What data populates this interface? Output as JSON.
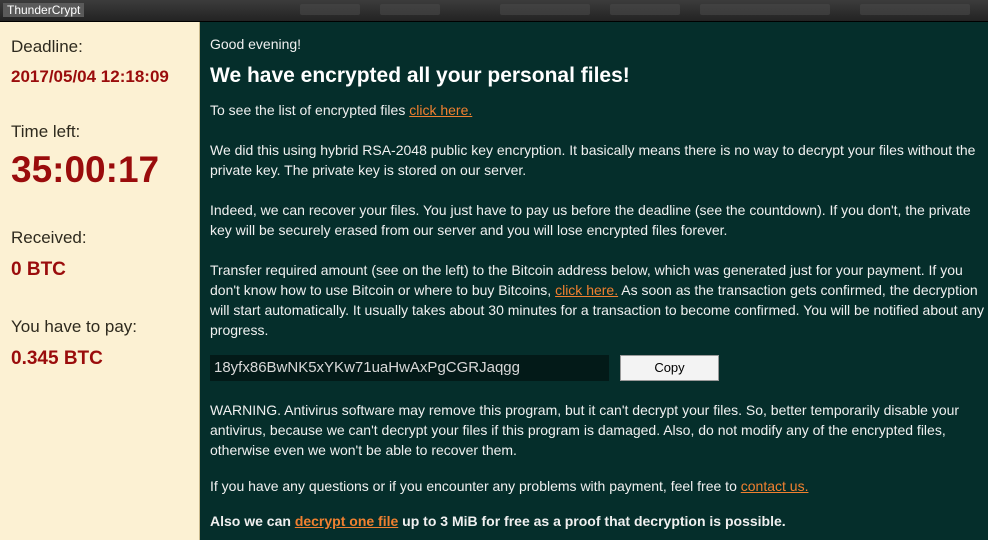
{
  "window": {
    "title": "ThunderCrypt"
  },
  "left_panel": {
    "deadline_label": "Deadline:",
    "deadline_value": "2017/05/04 12:18:09",
    "time_left_label": "Time left:",
    "time_left_value": "35:00:17",
    "received_label": "Received:",
    "received_value": "0 BTC",
    "to_pay_label": "You have to pay:",
    "to_pay_value": "0.345 BTC"
  },
  "main": {
    "greeting": "Good evening!",
    "headline": "We have encrypted all your personal files!",
    "list_text": "To see the list of encrypted files ",
    "list_link": "click here.",
    "para_encryption": "We did this using hybrid RSA-2048 public key encryption. It basically means there is no way to decrypt your files without the private key. The private key is stored on our server.",
    "para_deadline": "Indeed, we can recover your files. You just have to pay us before the deadline (see the countdown). If you don't, the private key will be securely erased from our server and you will lose encrypted files forever.",
    "para_transfer_1": "Transfer required amount (see on the left) to the Bitcoin address below, which was generated just for your payment. If you don't know how to use Bitcoin or where to buy Bitcoins, ",
    "para_transfer_link": "click here.",
    "para_transfer_2": " As soon as the transaction gets confirmed, the decryption will start automatically. It usually takes about 30 minutes for a transaction to become confirmed. You will be notified about any progress.",
    "bitcoin_address": "18yfx86BwNK5xYKw71uaHwAxPgCGRJaqgg",
    "copy_label": "Copy",
    "warning": "WARNING. Antivirus software may remove this program, but it can't decrypt your files. So, better temporarily disable your antivirus, because we can't decrypt your files if this program is damaged. Also, do not modify any of the encrypted files, otherwise even we won't be able to recover them.",
    "contact_text": "If you have any questions or if you encounter any problems with payment, feel free to ",
    "contact_link": "contact us.",
    "free_text_1": "Also we can ",
    "free_link": "decrypt one file",
    "free_text_2": " up to 3 MiB for free as a proof that decryption is possible."
  },
  "colors": {
    "left_bg": "#fcf1d3",
    "right_bg": "#052e2b",
    "accent_red": "#9a0c0c",
    "link": "#f08030"
  }
}
